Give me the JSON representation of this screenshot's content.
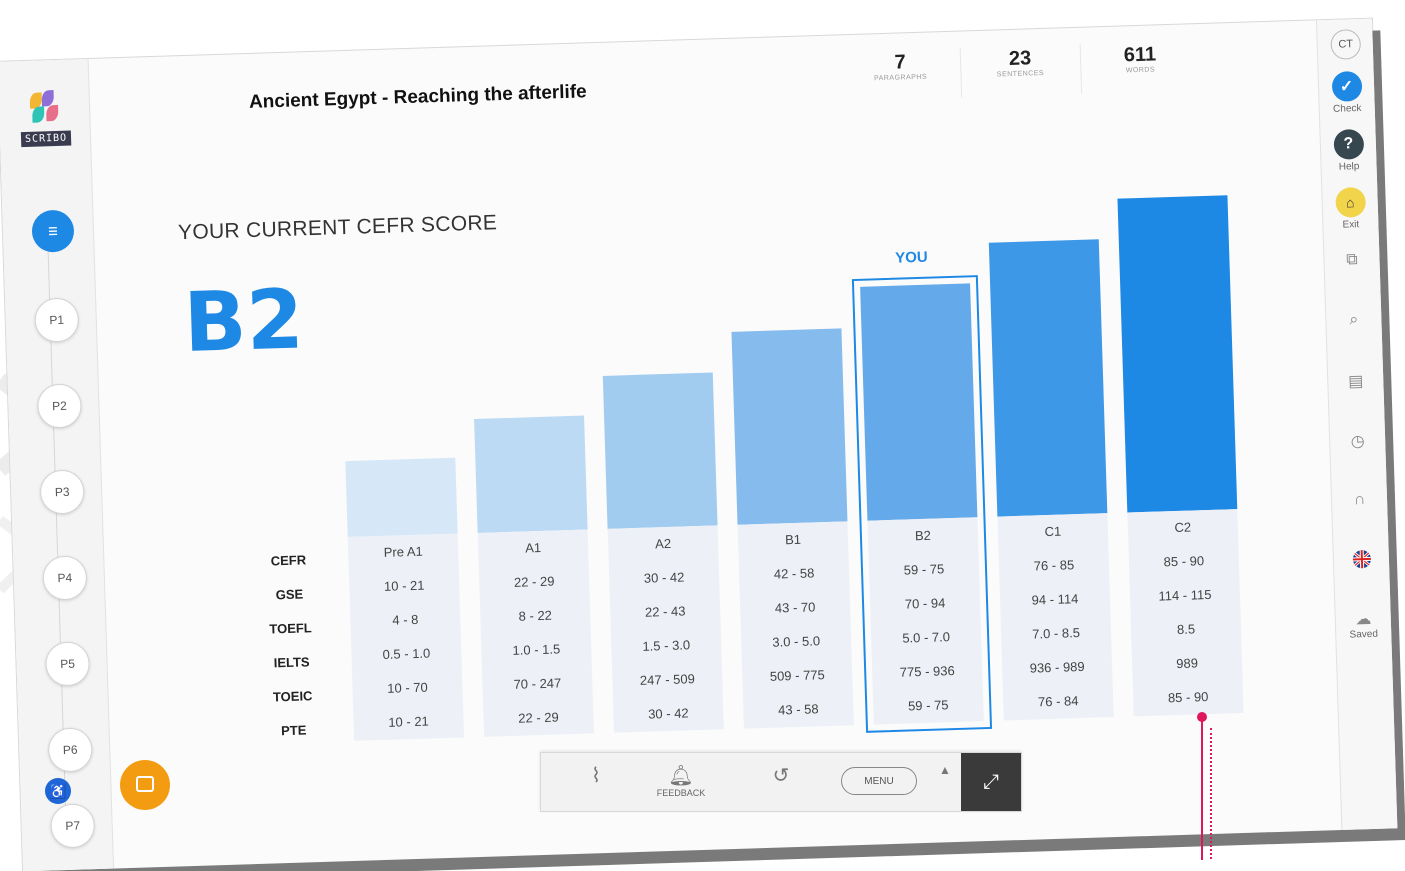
{
  "doc": {
    "title": "Ancient Egypt - Reaching the afterlife",
    "stats": [
      {
        "value": "7",
        "label": "PARAGRAPHS"
      },
      {
        "value": "23",
        "label": "SENTENCES"
      },
      {
        "value": "611",
        "label": "WORDS"
      }
    ]
  },
  "logo": {
    "text": "SCRIBO"
  },
  "sidebar": {
    "paragraphs": [
      "P1",
      "P2",
      "P3",
      "P4",
      "P5",
      "P6",
      "P7"
    ]
  },
  "score": {
    "heading": "YOUR CURRENT CEFR SCORE",
    "level": "B2",
    "you_label": "YOU",
    "row_labels": [
      "CEFR",
      "GSE",
      "TOEFL",
      "IELTS",
      "TOEIC",
      "PTE"
    ],
    "columns": [
      {
        "cefr": "Pre A1",
        "gse": "10 - 21",
        "toefl": "4 - 8",
        "ielts": "0.5 - 1.0",
        "toeic": "10 - 70",
        "pte": "10 - 21",
        "color": "#d6e8f8"
      },
      {
        "cefr": "A1",
        "gse": "22 - 29",
        "toefl": "8 - 22",
        "ielts": "1.0 - 1.5",
        "toeic": "70 - 247",
        "pte": "22 - 29",
        "color": "#bddaf5"
      },
      {
        "cefr": "A2",
        "gse": "30 - 42",
        "toefl": "22 - 43",
        "ielts": "1.5 - 3.0",
        "toeic": "247 - 509",
        "pte": "30 - 42",
        "color": "#a2cbf0"
      },
      {
        "cefr": "B1",
        "gse": "42 - 58",
        "toefl": "43 - 70",
        "ielts": "3.0 - 5.0",
        "toeic": "509 - 775",
        "pte": "43 - 58",
        "color": "#86bbee"
      },
      {
        "cefr": "B2",
        "gse": "59 - 75",
        "toefl": "70 - 94",
        "ielts": "5.0 - 7.0",
        "toeic": "775 - 936",
        "pte": "59 - 75",
        "color": "#64aaea"
      },
      {
        "cefr": "C1",
        "gse": "76 - 85",
        "toefl": "94 - 114",
        "ielts": "7.0 - 8.5",
        "toeic": "936 - 989",
        "pte": "76 - 84",
        "color": "#3e98e8"
      },
      {
        "cefr": "C2",
        "gse": "85 - 90",
        "toefl": "114 - 115",
        "ielts": "8.5",
        "toeic": "989",
        "pte": "85 - 90",
        "color": "#1e88e5"
      }
    ]
  },
  "right_toolbar": {
    "user_initials": "CT",
    "check": "Check",
    "help": "Help",
    "exit": "Exit",
    "saved": "Saved",
    "icons": [
      "copy-icon",
      "search-icon",
      "document-icon",
      "history-icon",
      "headphones-icon",
      "uk-flag-icon"
    ]
  },
  "bottom_toolbar": {
    "feedback": "FEEDBACK",
    "menu": "MENU"
  },
  "colors": {
    "accent": "#1e88e5",
    "orange": "#f39c12",
    "pin": "#e0165c"
  }
}
